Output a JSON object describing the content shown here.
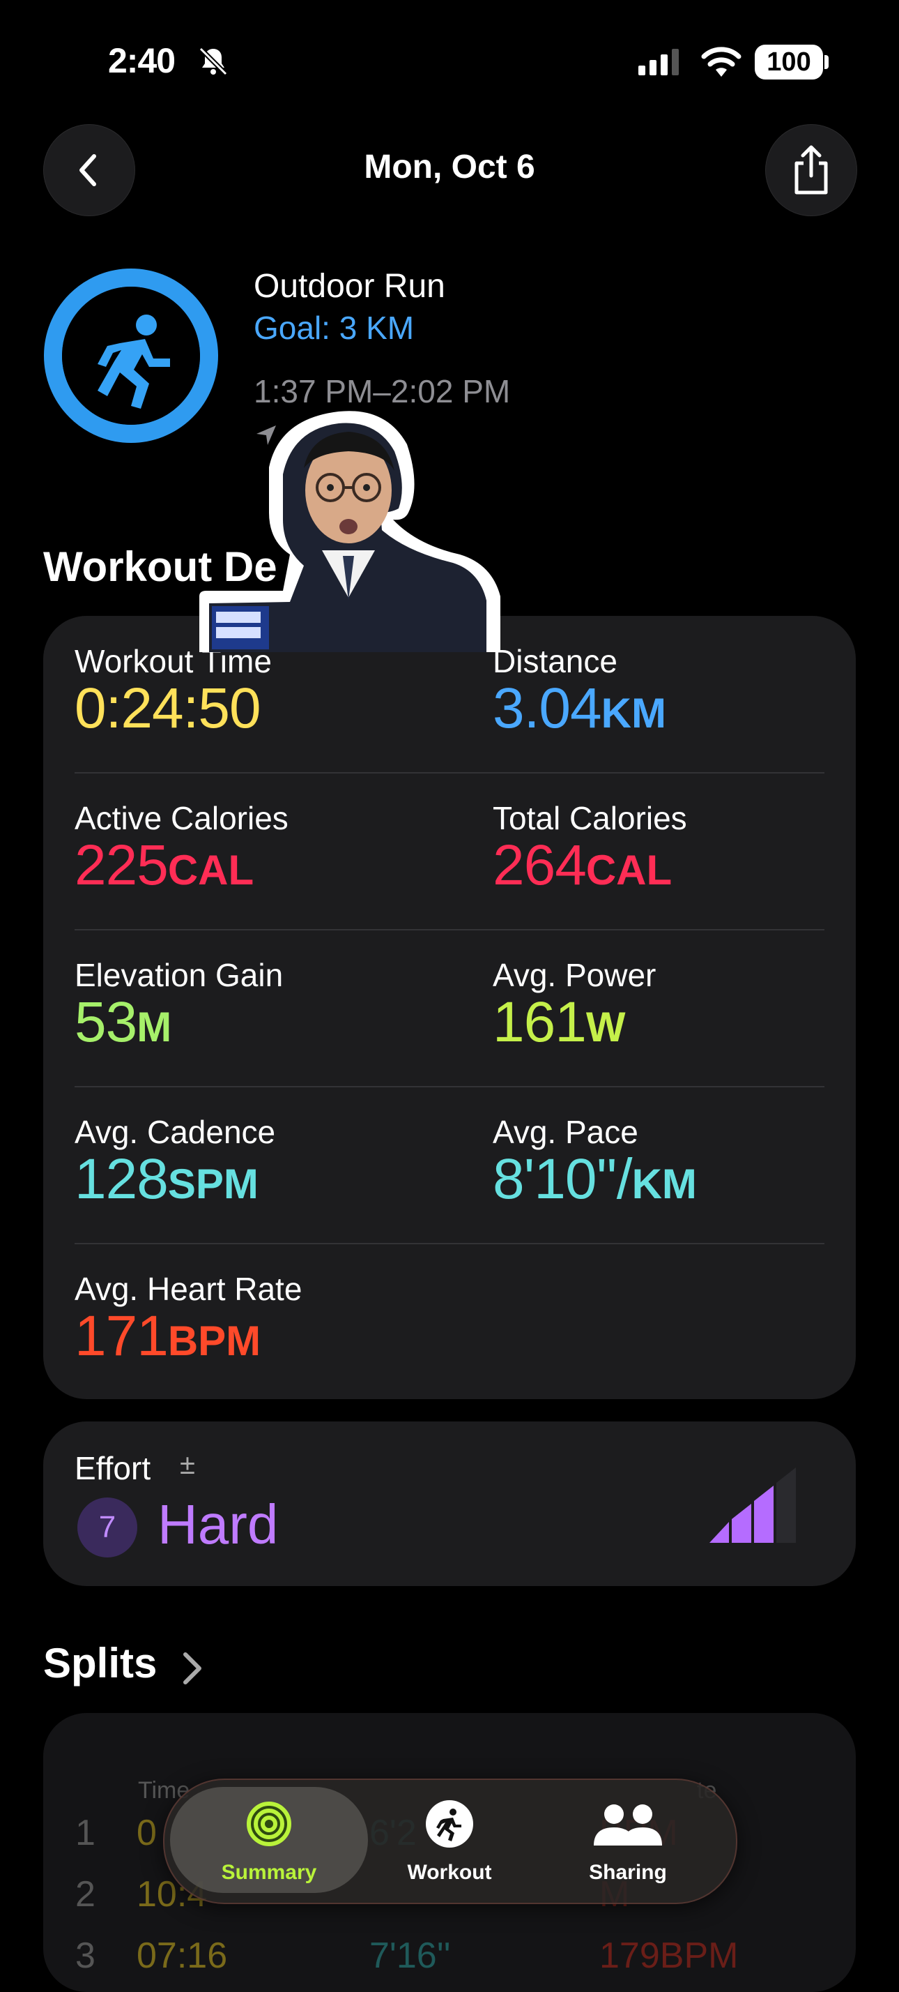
{
  "status": {
    "time": "2:40",
    "battery": "100"
  },
  "header": {
    "title": "Mon, Oct 6"
  },
  "workout": {
    "name": "Outdoor Run",
    "goal": "Goal: 3 KM",
    "time_range": "1:37 PM–2:02 PM"
  },
  "details": {
    "title": "Workout De",
    "stats": [
      {
        "label": "Workout Time",
        "value": "0:24:50",
        "unit": "",
        "color": "#ffe15a"
      },
      {
        "label": "Distance",
        "value": "3.04",
        "unit": "KM",
        "color": "#4aa8ff"
      },
      {
        "label": "Active Calories",
        "value": "225",
        "unit": "CAL",
        "color": "#ff2d55"
      },
      {
        "label": "Total Calories",
        "value": "264",
        "unit": "CAL",
        "color": "#ff2d55"
      },
      {
        "label": "Elevation Gain",
        "value": "53",
        "unit": "M",
        "color": "#a6f06a"
      },
      {
        "label": "Avg. Power",
        "value": "161",
        "unit": "W",
        "color": "#c5f04a"
      },
      {
        "label": "Avg. Cadence",
        "value": "128",
        "unit": "SPM",
        "color": "#66e0e0"
      },
      {
        "label": "Avg. Pace",
        "value": "8'10''/",
        "unit": "KM",
        "color": "#66e0e0"
      },
      {
        "label": "Avg. Heart Rate",
        "value": "171",
        "unit": "BPM",
        "color": "#ff4a2a"
      }
    ]
  },
  "effort": {
    "label": "Effort",
    "pm": "±",
    "level": "7",
    "word": "Hard"
  },
  "splits": {
    "title": "Splits",
    "col_time": "Time",
    "col_rate": "te",
    "rows": [
      {
        "num": "1",
        "time": "0",
        "pace": "6'2",
        "rate": "BPM"
      },
      {
        "num": "2",
        "time": "10:4",
        "pace": "",
        "rate": "M"
      },
      {
        "num": "3",
        "time": "07:16",
        "pace": "7'16''",
        "rate": "179BPM"
      }
    ]
  },
  "tabs": [
    {
      "label": "Summary"
    },
    {
      "label": "Workout"
    },
    {
      "label": "Sharing"
    }
  ]
}
